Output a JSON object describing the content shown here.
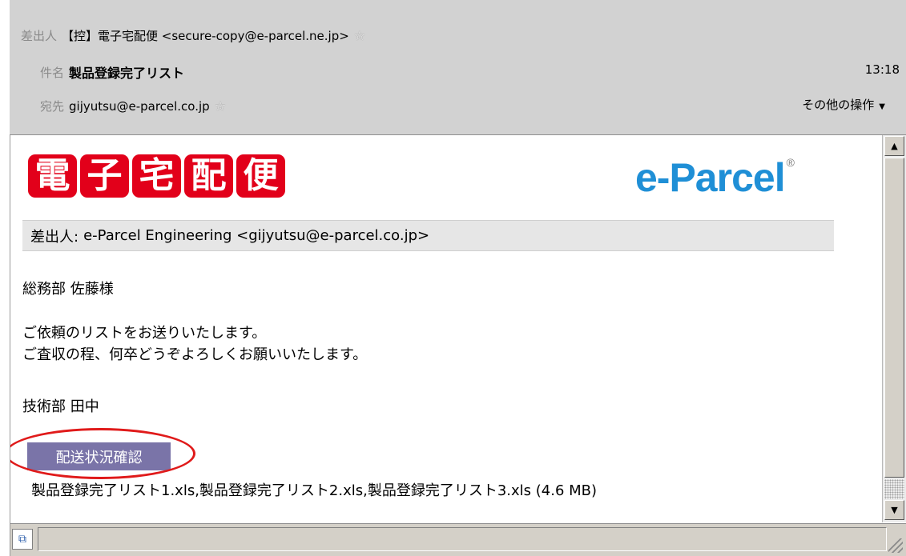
{
  "header": {
    "from_label": "差出人",
    "from_value": "【控】電子宅配便 <secure-copy@e-parcel.ne.jp>",
    "subject_label": "件名",
    "subject_value": "製品登録完了リスト",
    "time": "13:18",
    "to_label": "宛先",
    "to_value": "gijyutsu@e-parcel.co.jp",
    "more_actions": "その他の操作",
    "star_icon": "star-outline-icon"
  },
  "logo": {
    "kanji": [
      "電",
      "子",
      "宅",
      "配",
      "便"
    ],
    "brand": "e-Parcel",
    "registered": "®"
  },
  "message": {
    "sender_label": "差出人:",
    "sender_value": "e-Parcel Engineering <gijyutsu@e-parcel.co.jp>",
    "recipient": "総務部 佐藤様",
    "body_line1": "ご依頼のリストをお送りいたします。",
    "body_line2": "ご査収の程、何卒どうぞよろしくお願いいたします。",
    "signature": "技術部 田中",
    "status_button": "配送状況確認",
    "attachments": "製品登録完了リスト1.xls,製品登録完了リスト2.xls,製品登録完了リスト3.xls (4.6 MB)"
  },
  "colors": {
    "logo_red": "#e2001a",
    "brand_blue": "#1f8fd6",
    "button_purple": "#7a74a8",
    "highlight_oval": "#e01a1a"
  }
}
